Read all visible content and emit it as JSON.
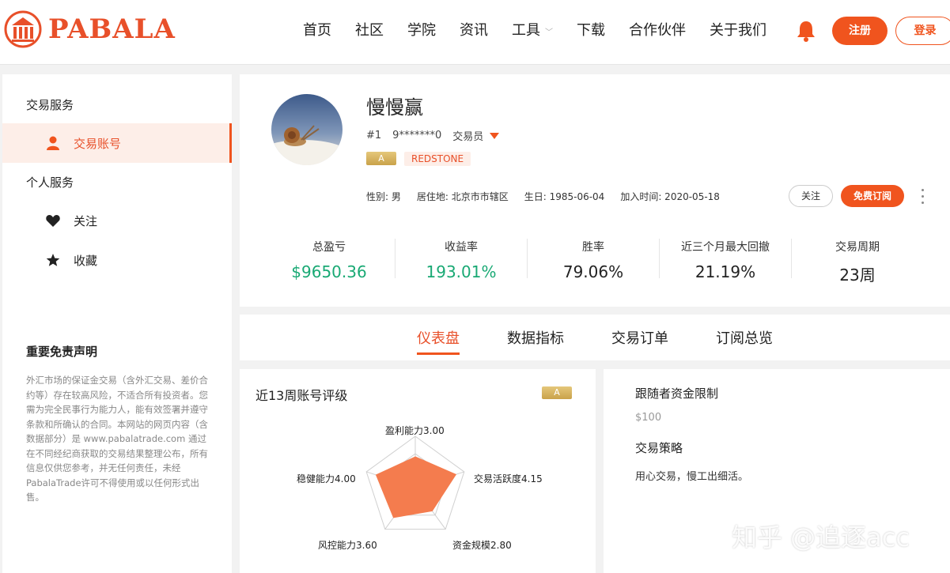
{
  "brand": {
    "name": "PABALA",
    "color": "#e8502a"
  },
  "nav": {
    "items": [
      "首页",
      "社区",
      "学院",
      "资讯",
      "工具",
      "下载",
      "合作伙伴",
      "关于我们"
    ],
    "tools_chevron": "﹀",
    "register": "注册",
    "login": "登录"
  },
  "sidebar": {
    "section1": "交易服务",
    "item_account": "交易账号",
    "section2": "个人服务",
    "item_follow": "关注",
    "item_favorite": "收藏",
    "disclaimer_title": "重要免责声明",
    "disclaimer_text": "外汇市场的保证金交易（含外汇交易、差价合约等）存在较高风险，不适合所有投资者。您需为完全民事行为能力人，能有效签署并遵守条款和所确认的合同。本网站的网页内容（含数据部分）是 www.pabalatrade.com 通过在不同经纪商获取的交易结果整理公布，所有信息仅供您参考，并无任何责任，未经 PabalaTrade许可不得使用或以任何形式出售。"
  },
  "profile": {
    "name": "慢慢赢",
    "rank": "#1",
    "account": "9*******0",
    "role": "交易员",
    "grade": "A",
    "broker": "REDSTONE",
    "gender": "性别: 男",
    "location": "居住地: 北京市市辖区",
    "birthday": "生日: 1985-06-04",
    "joined": "加入时间: 2020-05-18",
    "follow_btn": "关注",
    "subscribe_btn": "免费订阅"
  },
  "stats": [
    {
      "label": "总盈亏",
      "value": "$9650.36",
      "positive": true
    },
    {
      "label": "收益率",
      "value": "193.01%",
      "positive": true
    },
    {
      "label": "胜率",
      "value": "79.06%",
      "positive": false
    },
    {
      "label": "近三个月最大回撤",
      "value": "21.19%",
      "positive": false
    },
    {
      "label": "交易周期",
      "value": "23周",
      "positive": false
    }
  ],
  "tabs": [
    "仪表盘",
    "数据指标",
    "交易订单",
    "订阅总览"
  ],
  "rating": {
    "title": "近13周账号评级",
    "grade": "A",
    "max": 5,
    "fill_color": "#f47c4e",
    "axes": [
      {
        "label": "盈利能力3.00",
        "value": 3.0
      },
      {
        "label": "交易活跃度4.15",
        "value": 4.15
      },
      {
        "label": "资金规模2.80",
        "value": 2.8
      },
      {
        "label": "风控能力3.60",
        "value": 3.6
      },
      {
        "label": "稳健能力4.00",
        "value": 4.0
      }
    ]
  },
  "follower": {
    "title": "跟随者资金限制",
    "value": "$100",
    "strategy_title": "交易策略",
    "strategy_text": "用心交易，慢工出细活。"
  },
  "watermark": "知乎 @追逐acc"
}
